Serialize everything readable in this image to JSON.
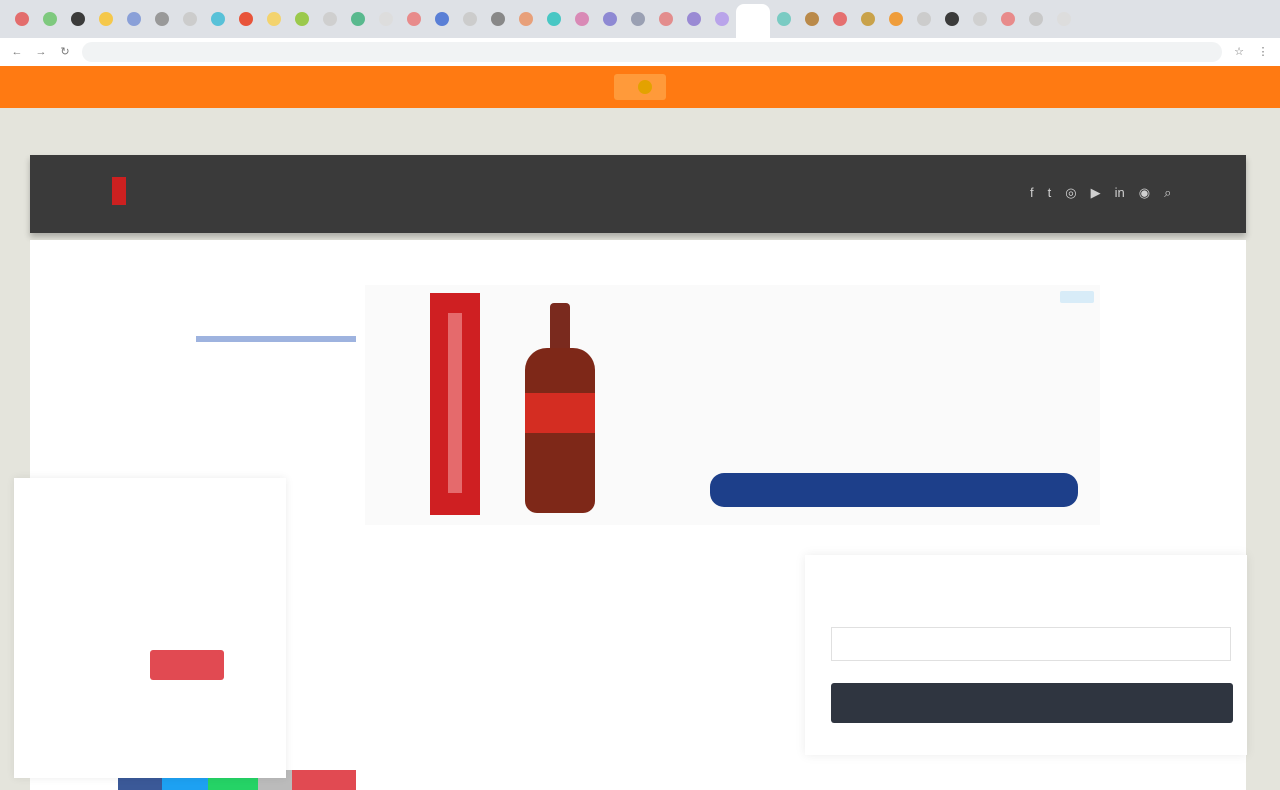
{
  "browser": {
    "tab_favicon_colors": [
      "#e36d6d",
      "#7ec97e",
      "#3b3b3b",
      "#f5c84b",
      "#8aa0d8",
      "#999999",
      "#cccccc",
      "#58c1d8",
      "#e8543a",
      "#f3d36e",
      "#9bc94c",
      "#cfcfcf",
      "#59b98e",
      "#dddddd",
      "#e88b8b",
      "#5a7fd6",
      "#cccccc",
      "#888888",
      "#e8a07a",
      "#48c7c4",
      "#d98ab6",
      "#8e89d3",
      "#9aa0b3",
      "#e38d8d",
      "#9a8ad4",
      "#b9a4ea",
      "#ffffff",
      "#7acbc3",
      "#ba8a4a",
      "#e57070",
      "#c9a24a",
      "#ef9d3b",
      "#cccccc",
      "#3b3b3b",
      "#d0d0d0",
      "#e88b8b",
      "#c8c8c8",
      "#dddddd"
    ],
    "url": "",
    "back_icon": "back-arrow-icon",
    "forward_icon": "forward-arrow-icon",
    "reload_icon": "reload-icon"
  },
  "promo": {
    "label": ""
  },
  "util_links": [
    "",
    "",
    "",
    "",
    "",
    "",
    "",
    "",
    ""
  ],
  "site": {
    "logo_text": "",
    "nav_items": [
      "",
      "",
      "",
      "",
      "",
      ""
    ],
    "social_icons": [
      "facebook-icon",
      "twitter-icon",
      "instagram-icon",
      "youtube-icon",
      "linkedin-icon",
      "rss-icon",
      "search-icon"
    ]
  },
  "left_ad": {
    "logo": "",
    "caption": ""
  },
  "main_ad": {
    "badge": "",
    "headline": "",
    "source": "",
    "description": "",
    "cta": ""
  },
  "cookie": {
    "text": "",
    "link": "",
    "accept_label": "",
    "accept_button": ""
  },
  "article": {
    "category": "",
    "title": "",
    "date": "",
    "author_prefix": "",
    "author": ""
  },
  "newsletter": {
    "title": "",
    "label": "",
    "placeholder": "",
    "button": ""
  },
  "share_colors": [
    "#3b5998",
    "#1da1f2",
    "#25d366",
    "#bbbbbb",
    "#e14a52"
  ]
}
